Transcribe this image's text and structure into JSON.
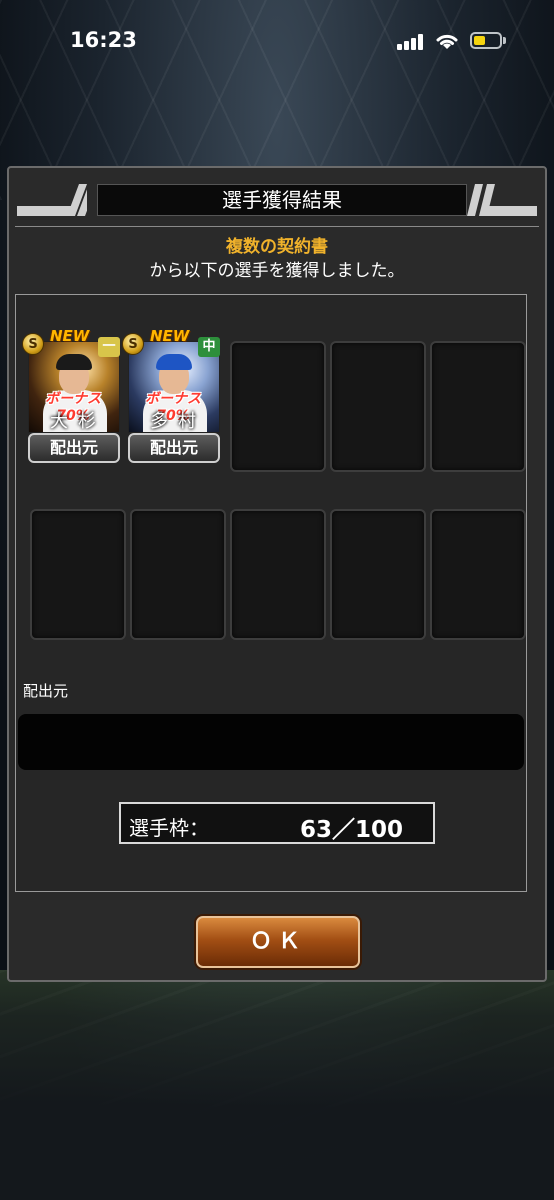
{
  "status_bar": {
    "time": "16:23"
  },
  "dialog": {
    "title": "選手獲得結果",
    "source_item": "複数の契約書",
    "message": "から以下の選手を獲得しました。",
    "cards": [
      {
        "new_label": "NEW",
        "rank": "S",
        "position": "一",
        "bonus": "ボーナス70%",
        "name": "大杉",
        "source_button": "配出元"
      },
      {
        "new_label": "NEW",
        "rank": "S",
        "position": "中",
        "bonus": "ボーナス70%",
        "name": "多村",
        "source_button": "配出元"
      }
    ],
    "source_label": "配出元",
    "source_value": "",
    "frame_label": "選手枠：",
    "frame_value": "63／100",
    "ok_label": "ＯＫ"
  },
  "colors": {
    "accent": "#f0b22b",
    "ok_button": "#a34f14",
    "bonus": "#ff3b30"
  }
}
